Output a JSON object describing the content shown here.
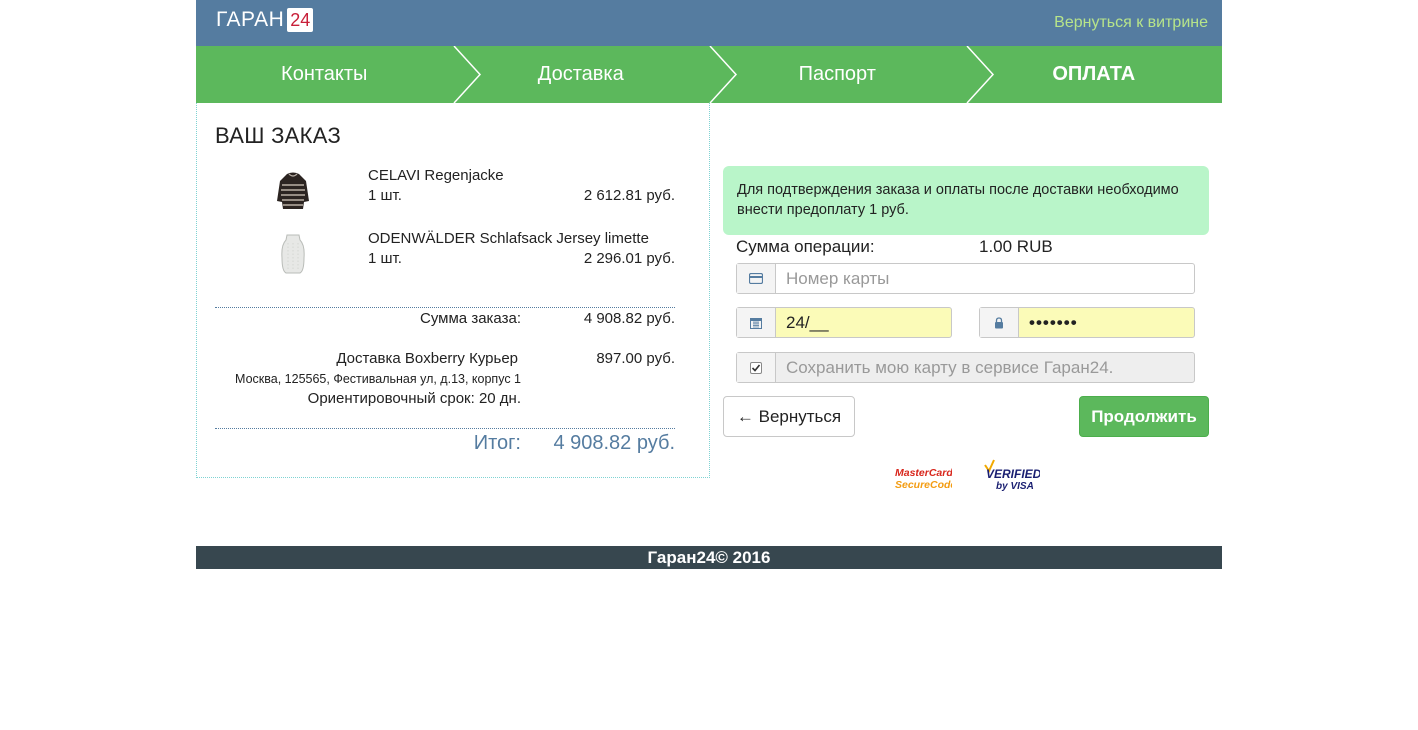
{
  "header": {
    "logo_text": "ГАРАН",
    "logo_badge": "24",
    "back_link": "Вернуться к витрине"
  },
  "steps": [
    {
      "label": "Контакты"
    },
    {
      "label": "Доставка"
    },
    {
      "label": "Паспорт"
    },
    {
      "label": "ОПЛАТА"
    }
  ],
  "order": {
    "title": "ВАШ ЗАКАЗ",
    "items": [
      {
        "name": "CELAVI Regenjacke",
        "qty": "1 шт.",
        "price": "2 612.81 руб.",
        "image_icon": "jacket-icon"
      },
      {
        "name": "ODENWÄLDER Schlafsack Jersey limette",
        "qty": "1 шт.",
        "price": "2 296.01 руб.",
        "image_icon": "sleeping-bag-icon"
      }
    ],
    "sum_label": "Сумма заказа:",
    "sum_value": "4 908.82 руб.",
    "delivery_label": "Доставка Boxberry Курьер",
    "delivery_value": "897.00 руб.",
    "delivery_address": "Москва, 125565, Фестивальная ул, д.13, корпус 1",
    "delivery_term": "Ориентировочный срок: 20 дн.",
    "total_label": "Итог:",
    "total_value": "4 908.82 руб."
  },
  "payment": {
    "notice": "Для подтверждения заказа и оплаты после доставки необходимо внести предоплату 1 руб.",
    "amount_label": "Сумма операции:",
    "amount_value": "1.00 RUB",
    "card_number_placeholder": "Номер карты",
    "card_number_value": "",
    "expiry_value": "24/__",
    "cvv_value": "•••••••",
    "save_card_label": "Сохранить мою карту в сервисе Гаран24.",
    "back_button": "← Вернуться",
    "continue_button": "Продолжить",
    "mastercard_line1": "MasterCard.",
    "mastercard_line2": "SecureCode",
    "visa_line1": "VERIFIED",
    "visa_line2": "by VISA"
  },
  "footer": {
    "text": "Гаран24© 2016"
  },
  "colors": {
    "header_bg": "#557ca0",
    "steps_bg": "#5cb85c",
    "notice_bg": "#b9f5c9",
    "autofill_bg": "#fbfbb8",
    "footer_bg": "#37474f",
    "link": "#b7e48a"
  }
}
